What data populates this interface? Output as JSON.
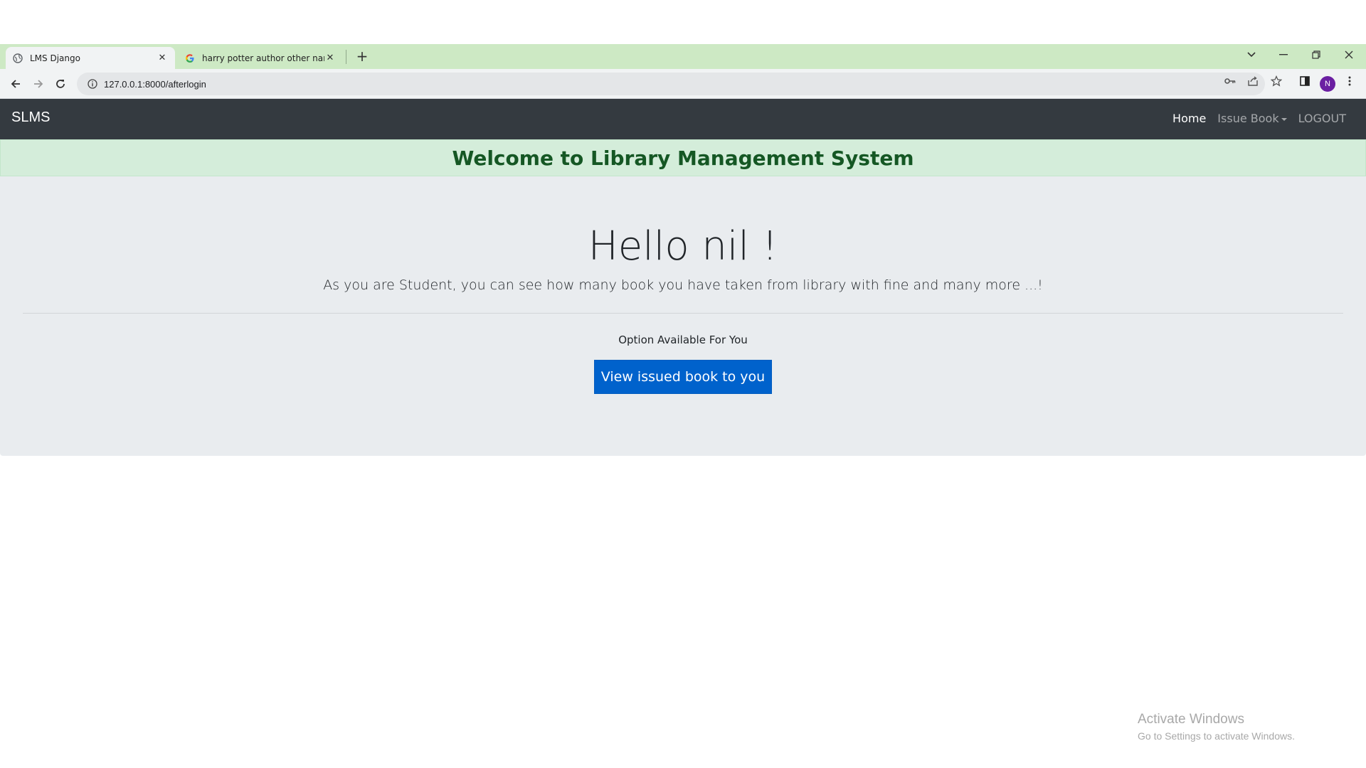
{
  "browser": {
    "tabs": [
      {
        "title": "LMS Django",
        "active": true,
        "favicon": "globe-icon"
      },
      {
        "title": "harry potter author other name",
        "active": false,
        "favicon": "google-icon"
      }
    ],
    "address_url": "127.0.0.1:8000/afterlogin",
    "profile_initial": "N",
    "profile_color": "#6b1fa2"
  },
  "site": {
    "brand": "SLMS",
    "nav": {
      "home": "Home",
      "issue_book": "Issue Book",
      "logout": "LOGOUT"
    },
    "welcome": "Welcome to Library Management System",
    "greeting": "Hello nil !",
    "lead": "As you are Student, you can see how many book you have taken from library with fine and many more ...!",
    "option_label": "Option Available For You",
    "primary_button": "View issued book to you"
  },
  "watermark": {
    "title": "Activate Windows",
    "subtitle": "Go to Settings to activate Windows."
  },
  "colors": {
    "tabstrip": "#cde9c4",
    "navbar": "#343a40",
    "welcome_bg": "#d4edda",
    "welcome_text": "#155724",
    "jumbotron": "#e9ecef",
    "primary": "#0062cc"
  }
}
